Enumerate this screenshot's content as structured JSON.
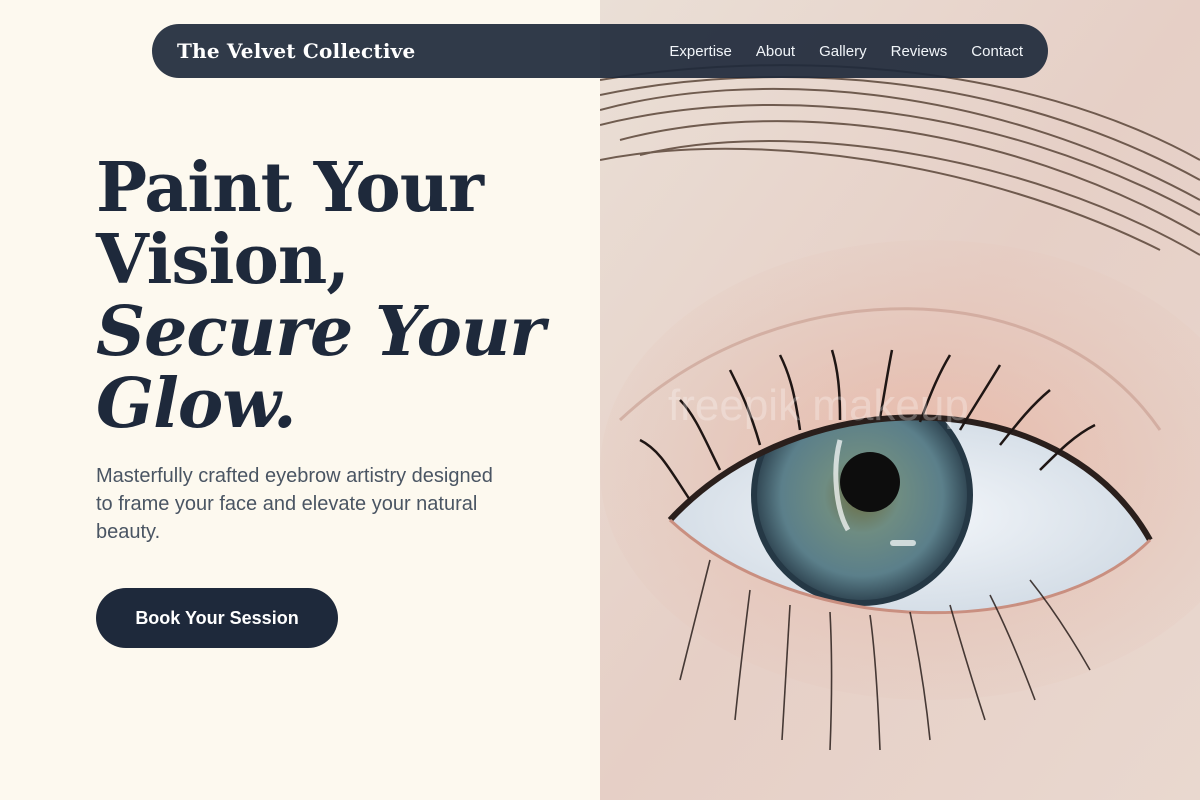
{
  "nav": {
    "brand": "The Velvet Collective",
    "links": [
      "Expertise",
      "About",
      "Gallery",
      "Reviews",
      "Contact"
    ]
  },
  "hero": {
    "headline_line1": "Paint Your",
    "headline_line2": "Vision,",
    "headline_line3": "Secure Your",
    "headline_line4": "Glow.",
    "subtext": "Masterfully crafted eyebrow artistry designed to frame your face and elevate your natural beauty.",
    "cta_label": "Book Your Session"
  },
  "image": {
    "subject": "close-up-eye-photo",
    "watermark": "freepik makeup"
  },
  "colors": {
    "background": "#fdf9ef",
    "primary": "#1e293b",
    "body_text": "#4a5563",
    "iris": "#5b7f8a"
  }
}
